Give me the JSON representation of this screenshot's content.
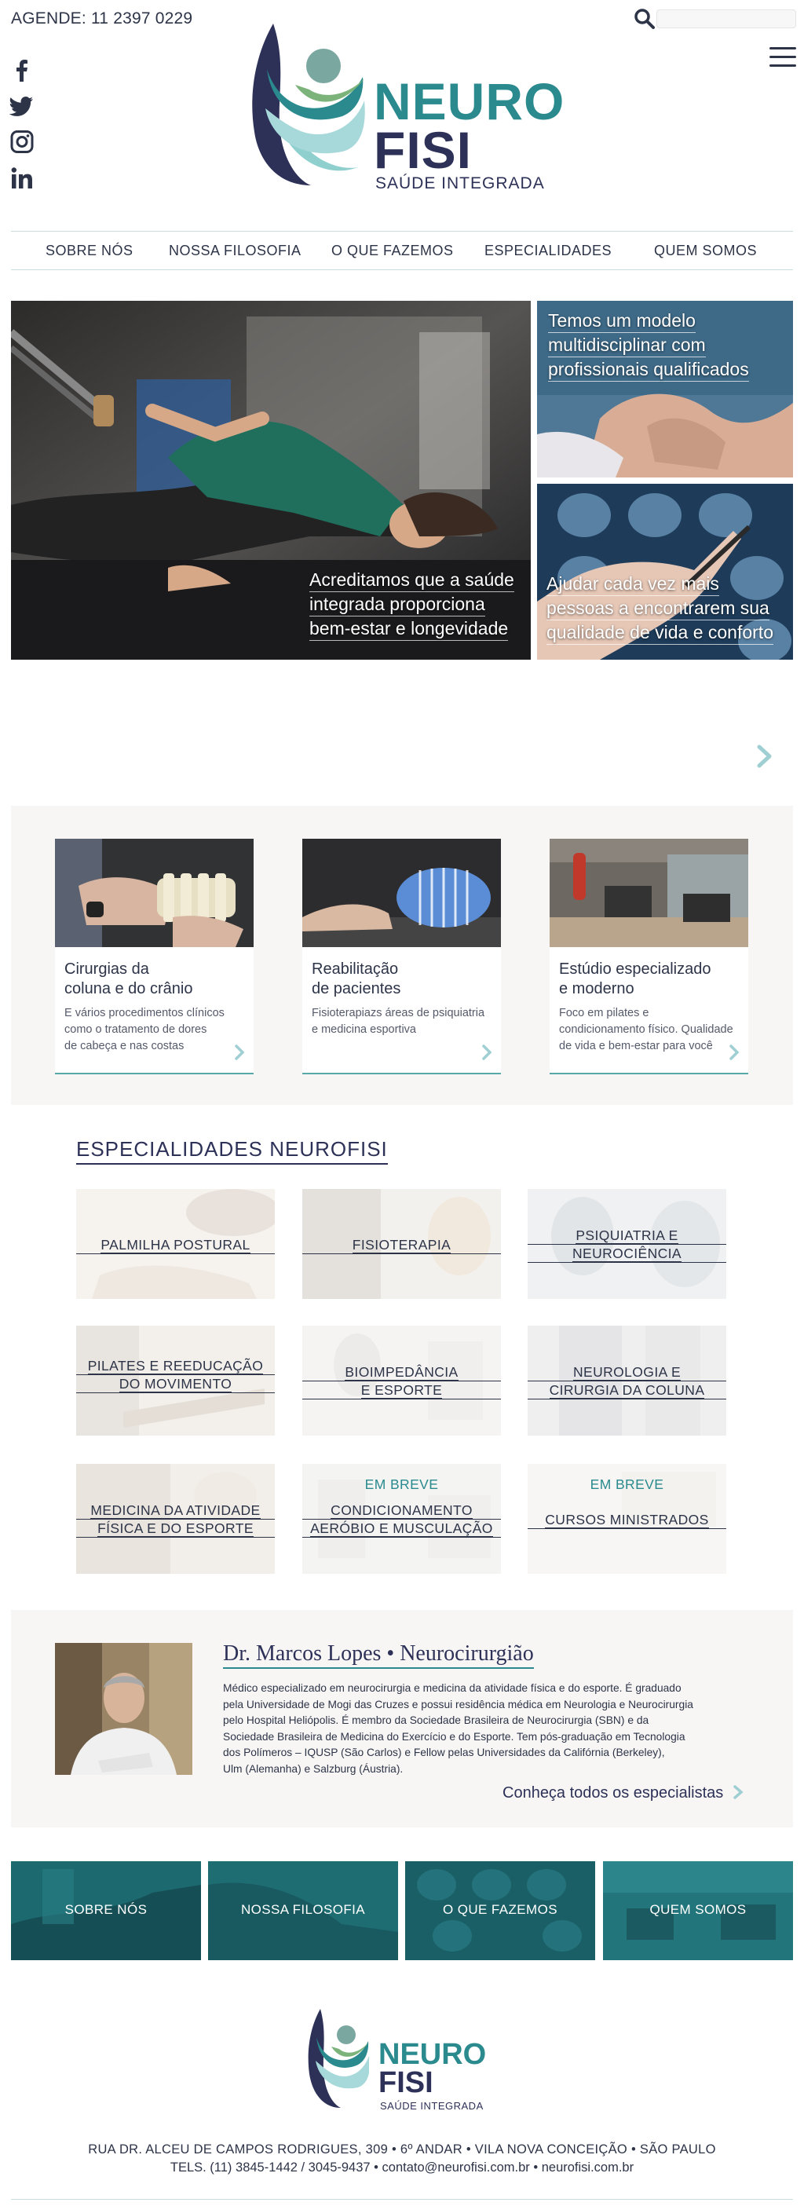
{
  "header": {
    "agende": "AGENDE: 11 2397 0229",
    "search_placeholder": "",
    "social_icons": [
      "facebook-icon",
      "twitter-icon",
      "instagram-icon",
      "linkedin-icon"
    ],
    "logo": {
      "line1": "NEURO",
      "line2": "FISI",
      "tagline": "SAÚDE INTEGRADA"
    }
  },
  "nav": {
    "items": [
      {
        "label": "SOBRE NÓS"
      },
      {
        "label": "NOSSA FILOSOFIA"
      },
      {
        "label": "O QUE FAZEMOS"
      },
      {
        "label": "ESPECIALIDADES"
      },
      {
        "label": "QUEM SOMOS"
      }
    ]
  },
  "hero": {
    "main": {
      "lines": [
        "Acreditamos que a saúde",
        "integrada proporciona",
        "bem-estar e longevidade"
      ]
    },
    "side1": {
      "lines": [
        "Temos um modelo",
        "multidisciplinar com",
        "profissionais qualificados"
      ]
    },
    "side2": {
      "lines": [
        "Ajudar cada vez mais",
        "pessoas a encontrarem sua",
        "qualidade de vida e conforto"
      ]
    }
  },
  "services": [
    {
      "title": [
        "Cirurgias da",
        "coluna e do crânio"
      ],
      "desc": [
        "E vários procedimentos clínicos",
        "como o tratamento de dores",
        "de cabeça e nas costas"
      ]
    },
    {
      "title": [
        "Reabilitação",
        "de pacientes"
      ],
      "desc": [
        "Fisioterapiazs áreas de psiquiatria",
        "e medicina esportiva"
      ]
    },
    {
      "title": [
        "Estúdio especializado",
        "e moderno"
      ],
      "desc": [
        "Foco em pilates e",
        "condicionamento físico. Qualidade",
        "de vida e bem-estar para você"
      ]
    }
  ],
  "especialidades": {
    "title": "ESPECIALIDADES NEUROFISI",
    "tiles": [
      {
        "lines": [
          "PALMILHA POSTURAL"
        ],
        "badge": ""
      },
      {
        "lines": [
          "FISIOTERAPIA"
        ],
        "badge": ""
      },
      {
        "lines": [
          "PSIQUIATRIA E",
          "NEUROCIÊNCIA"
        ],
        "badge": ""
      },
      {
        "lines": [
          "PILATES E REEDUCAÇÃO",
          "DO MOVIMENTO"
        ],
        "badge": ""
      },
      {
        "lines": [
          "BIOIMPEDÂNCIA",
          "E ESPORTE"
        ],
        "badge": ""
      },
      {
        "lines": [
          "NEUROLOGIA E",
          "CIRURGIA DA COLUNA"
        ],
        "badge": ""
      },
      {
        "lines": [
          "MEDICINA DA ATIVIDADE",
          "FÍSICA E DO ESPORTE"
        ],
        "badge": ""
      },
      {
        "lines": [
          "CONDICIONAMENTO",
          "AERÓBIO E MUSCULAÇÃO"
        ],
        "badge": "EM BREVE"
      },
      {
        "lines": [
          "CURSOS MINISTRADOS"
        ],
        "badge": "EM BREVE"
      }
    ]
  },
  "doctor": {
    "name": "Dr. Marcos Lopes • Neurocirurgião",
    "bio": [
      "Médico especializado em neurocirurgia e medicina da atividade física e do esporte. É graduado",
      "pela Universidade de Mogi das Cruzes e possui residência médica em Neurologia e Neurocirurgia",
      "pelo Hospital Heliópolis. É membro da Sociedade Brasileira de Neurocirurgia (SBN) e da",
      "Sociedade Brasileira de Medicina do Exercício e do Esporte. Tem pós-graduação em Tecnologia",
      "dos Polímeros – IQUSP (São Carlos) e Fellow pelas Universidades da Califórnia (Berkeley),",
      "Ulm (Alemanha) e Salzburg (Áustria)."
    ],
    "link": "Conheça todos os especialistas"
  },
  "bottom_tiles": [
    {
      "label": "SOBRE NÓS"
    },
    {
      "label": "NOSSA FILOSOFIA"
    },
    {
      "label": "O QUE FAZEMOS"
    },
    {
      "label": "QUEM SOMOS"
    }
  ],
  "footer": {
    "logo": {
      "line1": "NEURO",
      "line2": "FISI",
      "tagline": "SAÚDE INTEGRADA"
    },
    "address": "RUA DR. ALCEU DE CAMPOS RODRIGUES, 309 • 6º ANDAR • VILA NOVA CONCEIÇÃO • SÃO PAULO",
    "contact": "TELS. (11) 3845-1442 / 3045-9437 • contato@neurofisi.com.br • neurofisi.com.br"
  },
  "colors": {
    "teal": "#2a8a8e",
    "navy": "#2d3158",
    "text": "#2d3448",
    "panel": "#f7f6f4",
    "arrow": "#9fcfd3"
  }
}
